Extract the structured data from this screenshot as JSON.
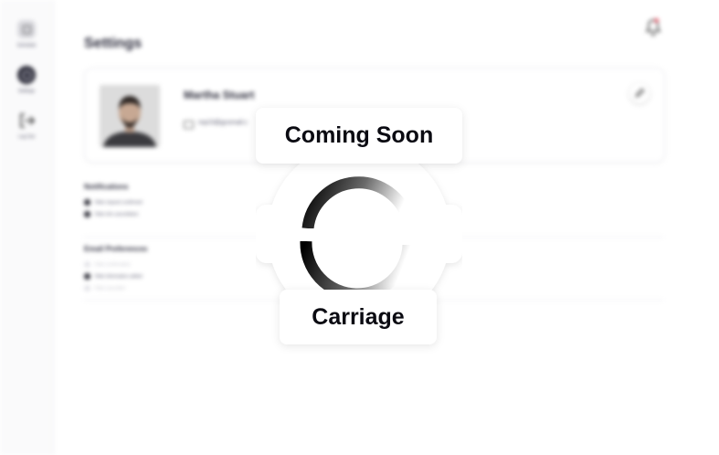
{
  "sidebar": {
    "items": [
      {
        "label": "Schedule",
        "icon": "calendar-icon"
      },
      {
        "label": "Settings",
        "icon": "gear-icon"
      },
      {
        "label": "Log Out",
        "icon": "logout-icon"
      }
    ]
  },
  "header": {
    "notification_icon": "bell-icon",
    "notification_dot_color": "#e25b6a"
  },
  "page": {
    "title": "Settings"
  },
  "profile": {
    "name": "Martha Stuart",
    "email": "mp23@gcomail.c",
    "edit_icon": "pencil-icon"
  },
  "notifications": {
    "title": "Notifications",
    "options": [
      {
        "label": "Ride request confirmed",
        "enabled": true
      },
      {
        "label": "Ride info cancellation",
        "enabled": true
      }
    ]
  },
  "email_preferences": {
    "title": "Email Preferences",
    "options": [
      {
        "label": "Ride confirmation",
        "enabled": false
      },
      {
        "label": "Ride information added",
        "enabled": true
      },
      {
        "label": "Ride cancelled",
        "enabled": false
      }
    ]
  },
  "overlay": {
    "title": "Coming Soon",
    "subtitle": "Carriage",
    "spinner_icon": "loading-spinner-icon"
  }
}
